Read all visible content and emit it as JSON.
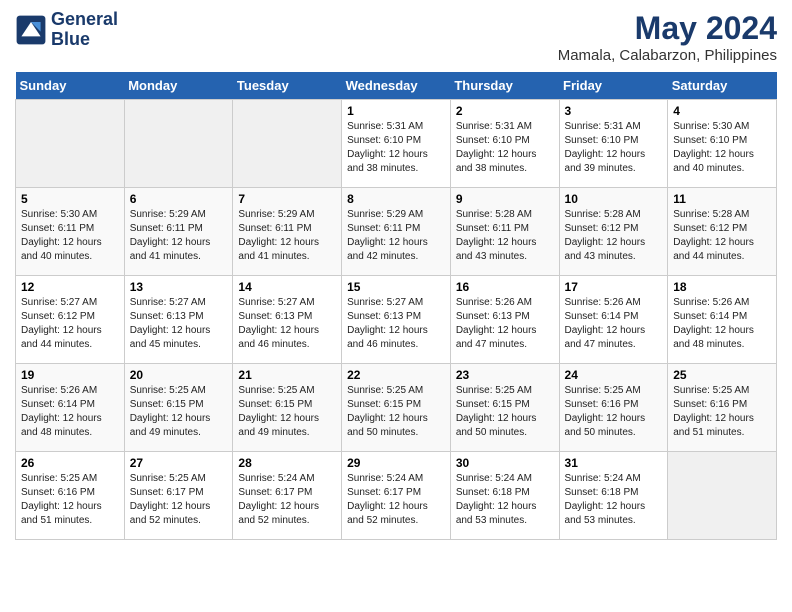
{
  "header": {
    "logo_line1": "General",
    "logo_line2": "Blue",
    "title": "May 2024",
    "subtitle": "Mamala, Calabarzon, Philippines"
  },
  "days_of_week": [
    "Sunday",
    "Monday",
    "Tuesday",
    "Wednesday",
    "Thursday",
    "Friday",
    "Saturday"
  ],
  "weeks": [
    [
      {
        "day": "",
        "info": ""
      },
      {
        "day": "",
        "info": ""
      },
      {
        "day": "",
        "info": ""
      },
      {
        "day": "1",
        "info": "Sunrise: 5:31 AM\nSunset: 6:10 PM\nDaylight: 12 hours\nand 38 minutes."
      },
      {
        "day": "2",
        "info": "Sunrise: 5:31 AM\nSunset: 6:10 PM\nDaylight: 12 hours\nand 38 minutes."
      },
      {
        "day": "3",
        "info": "Sunrise: 5:31 AM\nSunset: 6:10 PM\nDaylight: 12 hours\nand 39 minutes."
      },
      {
        "day": "4",
        "info": "Sunrise: 5:30 AM\nSunset: 6:10 PM\nDaylight: 12 hours\nand 40 minutes."
      }
    ],
    [
      {
        "day": "5",
        "info": "Sunrise: 5:30 AM\nSunset: 6:11 PM\nDaylight: 12 hours\nand 40 minutes."
      },
      {
        "day": "6",
        "info": "Sunrise: 5:29 AM\nSunset: 6:11 PM\nDaylight: 12 hours\nand 41 minutes."
      },
      {
        "day": "7",
        "info": "Sunrise: 5:29 AM\nSunset: 6:11 PM\nDaylight: 12 hours\nand 41 minutes."
      },
      {
        "day": "8",
        "info": "Sunrise: 5:29 AM\nSunset: 6:11 PM\nDaylight: 12 hours\nand 42 minutes."
      },
      {
        "day": "9",
        "info": "Sunrise: 5:28 AM\nSunset: 6:11 PM\nDaylight: 12 hours\nand 43 minutes."
      },
      {
        "day": "10",
        "info": "Sunrise: 5:28 AM\nSunset: 6:12 PM\nDaylight: 12 hours\nand 43 minutes."
      },
      {
        "day": "11",
        "info": "Sunrise: 5:28 AM\nSunset: 6:12 PM\nDaylight: 12 hours\nand 44 minutes."
      }
    ],
    [
      {
        "day": "12",
        "info": "Sunrise: 5:27 AM\nSunset: 6:12 PM\nDaylight: 12 hours\nand 44 minutes."
      },
      {
        "day": "13",
        "info": "Sunrise: 5:27 AM\nSunset: 6:13 PM\nDaylight: 12 hours\nand 45 minutes."
      },
      {
        "day": "14",
        "info": "Sunrise: 5:27 AM\nSunset: 6:13 PM\nDaylight: 12 hours\nand 46 minutes."
      },
      {
        "day": "15",
        "info": "Sunrise: 5:27 AM\nSunset: 6:13 PM\nDaylight: 12 hours\nand 46 minutes."
      },
      {
        "day": "16",
        "info": "Sunrise: 5:26 AM\nSunset: 6:13 PM\nDaylight: 12 hours\nand 47 minutes."
      },
      {
        "day": "17",
        "info": "Sunrise: 5:26 AM\nSunset: 6:14 PM\nDaylight: 12 hours\nand 47 minutes."
      },
      {
        "day": "18",
        "info": "Sunrise: 5:26 AM\nSunset: 6:14 PM\nDaylight: 12 hours\nand 48 minutes."
      }
    ],
    [
      {
        "day": "19",
        "info": "Sunrise: 5:26 AM\nSunset: 6:14 PM\nDaylight: 12 hours\nand 48 minutes."
      },
      {
        "day": "20",
        "info": "Sunrise: 5:25 AM\nSunset: 6:15 PM\nDaylight: 12 hours\nand 49 minutes."
      },
      {
        "day": "21",
        "info": "Sunrise: 5:25 AM\nSunset: 6:15 PM\nDaylight: 12 hours\nand 49 minutes."
      },
      {
        "day": "22",
        "info": "Sunrise: 5:25 AM\nSunset: 6:15 PM\nDaylight: 12 hours\nand 50 minutes."
      },
      {
        "day": "23",
        "info": "Sunrise: 5:25 AM\nSunset: 6:15 PM\nDaylight: 12 hours\nand 50 minutes."
      },
      {
        "day": "24",
        "info": "Sunrise: 5:25 AM\nSunset: 6:16 PM\nDaylight: 12 hours\nand 50 minutes."
      },
      {
        "day": "25",
        "info": "Sunrise: 5:25 AM\nSunset: 6:16 PM\nDaylight: 12 hours\nand 51 minutes."
      }
    ],
    [
      {
        "day": "26",
        "info": "Sunrise: 5:25 AM\nSunset: 6:16 PM\nDaylight: 12 hours\nand 51 minutes."
      },
      {
        "day": "27",
        "info": "Sunrise: 5:25 AM\nSunset: 6:17 PM\nDaylight: 12 hours\nand 52 minutes."
      },
      {
        "day": "28",
        "info": "Sunrise: 5:24 AM\nSunset: 6:17 PM\nDaylight: 12 hours\nand 52 minutes."
      },
      {
        "day": "29",
        "info": "Sunrise: 5:24 AM\nSunset: 6:17 PM\nDaylight: 12 hours\nand 52 minutes."
      },
      {
        "day": "30",
        "info": "Sunrise: 5:24 AM\nSunset: 6:18 PM\nDaylight: 12 hours\nand 53 minutes."
      },
      {
        "day": "31",
        "info": "Sunrise: 5:24 AM\nSunset: 6:18 PM\nDaylight: 12 hours\nand 53 minutes."
      },
      {
        "day": "",
        "info": ""
      }
    ]
  ]
}
